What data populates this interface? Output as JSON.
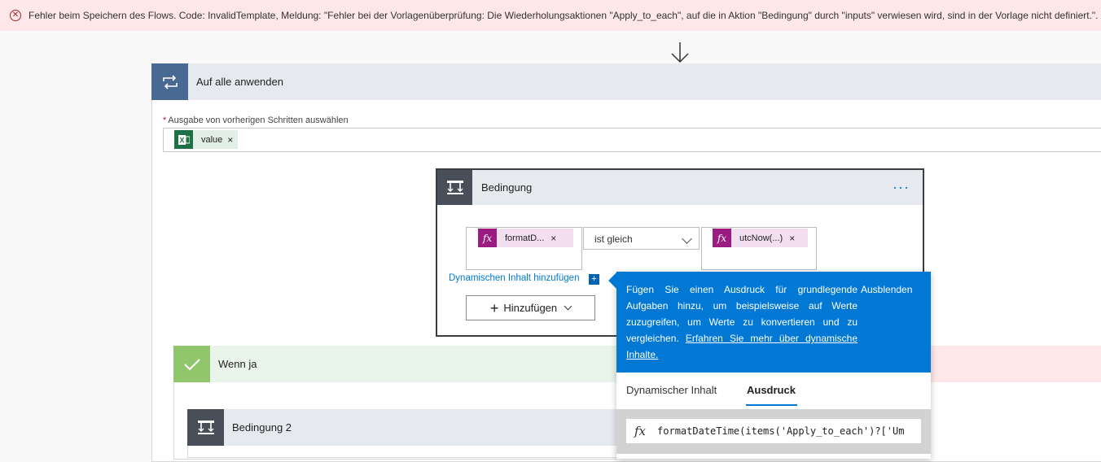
{
  "error_banner": {
    "icon": "error-circle-icon",
    "message": "Fehler beim Speichern des Flows. Code: InvalidTemplate, Meldung: \"Fehler bei der Vorlagenüberprüfung: Die Wiederholungsaktionen \"Apply_to_each\", auf die in Aktion \"Bedingung\" durch \"inputs\" verwiesen wird, sind in der Vorlage nicht definiert.\"."
  },
  "apply_to_each": {
    "title": "Auf alle anwenden",
    "icon": "loop-icon",
    "output_label": "Ausgabe von vorherigen Schritten auswählen",
    "required_mark": "*",
    "token": {
      "label": "value",
      "remove": "×",
      "icon": "excel-icon"
    }
  },
  "condition": {
    "title": "Bedingung",
    "more": "···",
    "left_token": {
      "label": "formatD...",
      "remove": "×",
      "icon_text": "fx"
    },
    "operator": "ist gleich",
    "right_token": {
      "label": "utcNow(...)",
      "remove": "×",
      "icon_text": "fx"
    },
    "dynamic_link": "Dynamischen Inhalt hinzufügen",
    "dynamic_plus": "+",
    "add_button": {
      "plus": "+",
      "label": "Hinzufügen"
    }
  },
  "branches": {
    "yes_title": "Wenn ja",
    "condition2_title": "Bedingung 2"
  },
  "popup": {
    "info_text": "Fügen Sie einen Ausdruck für grundlegende Aufgaben hinzu, um beispielsweise auf Werte zuzugreifen, um Werte zu konvertieren und zu vergleichen.",
    "info_link": "Erfahren Sie mehr über dynamische Inhalte.",
    "hide_label": "Ausblenden",
    "tabs": [
      "Dynamischer Inhalt",
      "Ausdruck"
    ],
    "active_tab": "Ausdruck",
    "expression_icon": "fx",
    "expression": "formatDateTime(items('Apply_to_each')?['Um"
  },
  "colors": {
    "accent": "#0078d4",
    "loop_icon_bg": "#486991",
    "condition_icon_bg": "#484f58",
    "yes_icon_bg": "#92c66d",
    "fx_token_bg": "#9a1b82",
    "excel_green": "#1e7145",
    "error_bg": "#fde7e9"
  }
}
